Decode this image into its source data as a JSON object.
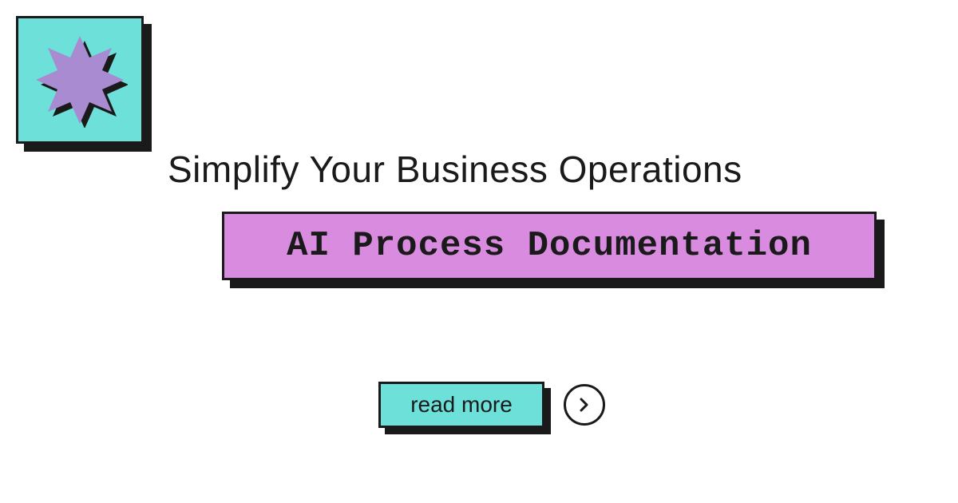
{
  "colors": {
    "teal": "#6ee0da",
    "purple": "#a88bd0",
    "pink": "#d98be0",
    "dark": "#1a1a1a"
  },
  "badge": {
    "icon_name": "starburst"
  },
  "headline": "Simplify Your Business Operations",
  "subtitle": "AI Process Documentation",
  "cta": {
    "label": "read more",
    "icon_name": "chevron-right"
  }
}
